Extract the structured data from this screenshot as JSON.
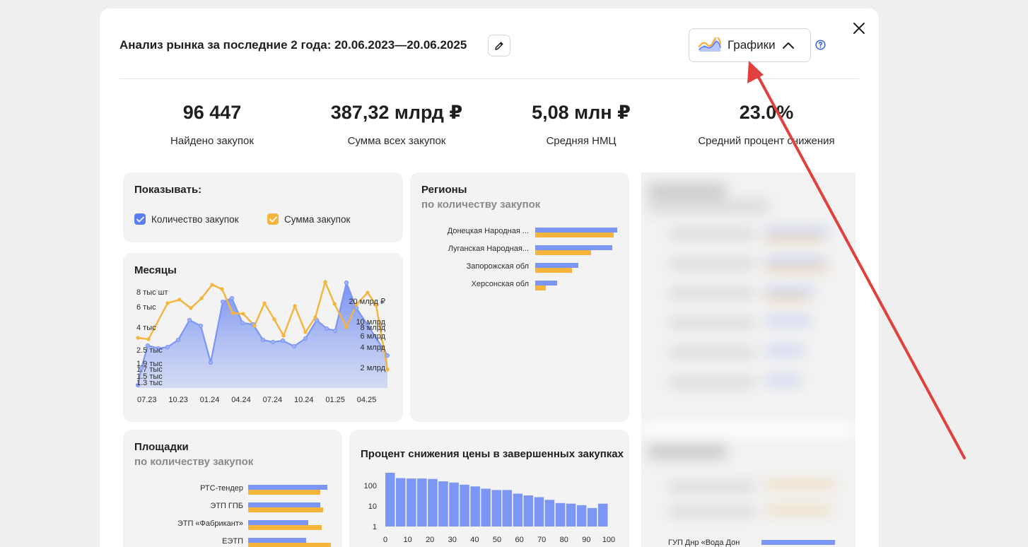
{
  "header": {
    "title": "Анализ рынка за последние 2 года: 20.06.2023—20.06.2025",
    "charts_button_label": "Графики"
  },
  "stats": [
    {
      "value": "96 447",
      "label": "Найдено закупок"
    },
    {
      "value": "387,32 млрд ₽",
      "label": "Сумма всех закупок"
    },
    {
      "value": "5,08 млн ₽",
      "label": "Средняя НМЦ"
    },
    {
      "value": "23.0%",
      "label": "Средний процент снижения"
    }
  ],
  "show_panel": {
    "title": "Показывать:",
    "options": [
      {
        "label": "Количество закупок",
        "checked": true,
        "color": "#5b7cf2"
      },
      {
        "label": "Сумма закупок",
        "checked": true,
        "color": "#f5b43c"
      }
    ]
  },
  "colors": {
    "blue": "#7b96f5",
    "orange": "#f5b43c",
    "arrow": "#e0413f",
    "help": "#3d63e0"
  },
  "months_chart": {
    "title": "Месяцы",
    "left_axis_labels": [
      "8 тыс шт",
      "6 тыс",
      "4 тыс",
      "2.5 тыс",
      "1.9 тыс",
      "1.7 тыс",
      "1.5 тыс",
      "1.3 тыс"
    ],
    "right_axis_labels": [
      "20 млрд ₽",
      "10 млрд",
      "8 млрд",
      "6 млрд",
      "4 млрд",
      "2 млрд"
    ],
    "x_labels": [
      "07.23",
      "10.23",
      "01.24",
      "04.24",
      "07.24",
      "10.24",
      "01.25",
      "04.25"
    ]
  },
  "regions_chart": {
    "title": "Регионы",
    "subtitle": "по количеству закупок",
    "rows": [
      {
        "label": "Донецкая Народная ...",
        "count": 100,
        "sum": 96
      },
      {
        "label": "Луганская Народная...",
        "count": 94,
        "sum": 68
      },
      {
        "label": "Запорожская обл",
        "count": 53,
        "sum": 45
      },
      {
        "label": "Херсонская обл",
        "count": 27,
        "sum": 13
      }
    ]
  },
  "platforms_chart": {
    "title": "Площадки",
    "subtitle": "по количеству закупок",
    "rows": [
      {
        "label": "РТС-тендер",
        "count": 96,
        "sum": 87
      },
      {
        "label": "ЭТП ГПБ",
        "count": 87,
        "sum": 91
      },
      {
        "label": "ЭТП «Фабрикант»",
        "count": 73,
        "sum": 89
      },
      {
        "label": "ЕЭТП",
        "count": 70,
        "sum": 100
      }
    ]
  },
  "chart_data": {
    "type": "bar",
    "title": "Процент снижения цены в завершенных закупках",
    "x_ticks": [
      "0",
      "10",
      "20",
      "30",
      "40",
      "50",
      "60",
      "70",
      "80",
      "90",
      "100"
    ],
    "y_ticks": [
      "100",
      "10",
      "1"
    ],
    "y_scale": "log",
    "categories": [
      0,
      5,
      10,
      15,
      20,
      25,
      30,
      35,
      40,
      45,
      50,
      55,
      60,
      65,
      70,
      75,
      80,
      85,
      90,
      95,
      100
    ],
    "values": [
      420,
      230,
      220,
      220,
      210,
      160,
      140,
      110,
      90,
      70,
      60,
      60,
      40,
      33,
      27,
      20,
      14,
      13,
      11,
      8,
      13
    ],
    "color": "#7b96f5"
  },
  "hidden_card_label": "ГУП Днр «Вода Дон"
}
